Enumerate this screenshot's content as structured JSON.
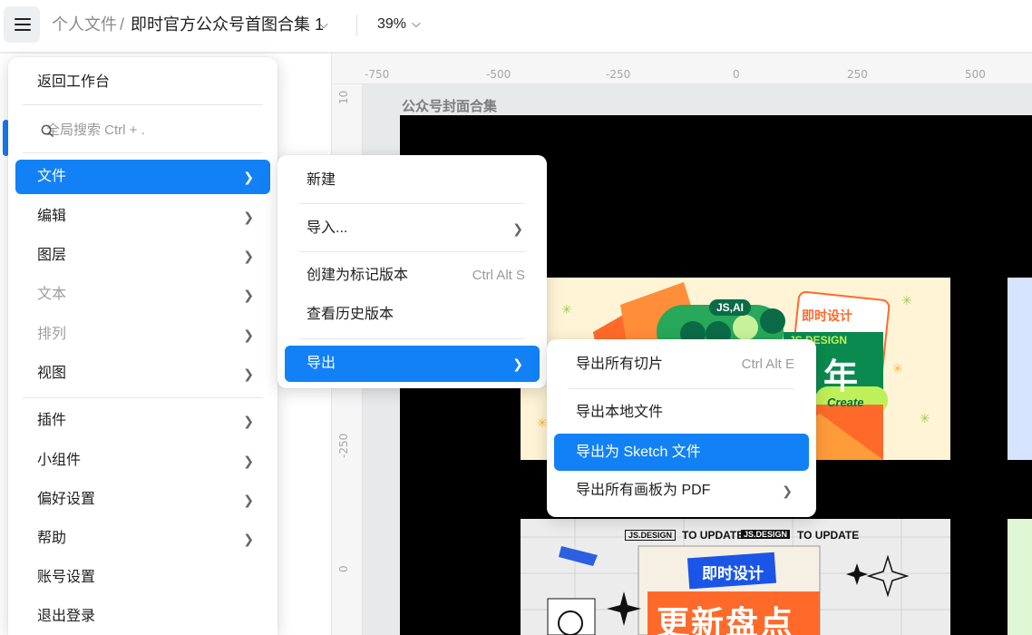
{
  "topbar": {
    "breadcrumb_personal": "个人文件",
    "breadcrumb_sep": "/",
    "file_name": "即时官方公众号首图合集 1",
    "zoom": "39%"
  },
  "canvas": {
    "frame_label": "公众号封面合集",
    "ruler_h": [
      "-750",
      "-500",
      "-250",
      "0",
      "250",
      "500"
    ],
    "ruler_v": [
      "10",
      "-250",
      "0"
    ],
    "card1": {
      "badge_ai": "JS,AI",
      "brand": "即时设计",
      "big": "年",
      "create": "Create",
      "ribbon": "JS DESIGN"
    },
    "card2": {
      "tag1": "JS.DESIGN",
      "upd1": "TO UPDATE",
      "tag2": "JS.DESIGN",
      "upd2": "TO UPDATE",
      "brand": "即时设计",
      "title": "更新盘点"
    }
  },
  "main_menu": {
    "back": "返回工作台",
    "search_placeholder": "全局搜索 Ctrl + .",
    "items": [
      {
        "label": "文件"
      },
      {
        "label": "编辑"
      },
      {
        "label": "图层"
      },
      {
        "label": "文本"
      },
      {
        "label": "排列"
      },
      {
        "label": "视图"
      },
      {
        "label": "插件"
      },
      {
        "label": "小组件"
      },
      {
        "label": "偏好设置"
      },
      {
        "label": "帮助"
      },
      {
        "label": "账号设置"
      },
      {
        "label": "退出登录"
      }
    ]
  },
  "file_menu": {
    "items": [
      {
        "label": "新建"
      },
      {
        "label": "导入..."
      },
      {
        "label": "创建为标记版本",
        "shortcut": "Ctrl Alt S"
      },
      {
        "label": "查看历史版本"
      },
      {
        "label": "导出"
      }
    ]
  },
  "export_menu": {
    "items": [
      {
        "label": "导出所有切片",
        "shortcut": "Ctrl Alt E"
      },
      {
        "label": "导出本地文件"
      },
      {
        "label": "导出为 Sketch 文件"
      },
      {
        "label": "导出所有画板为 PDF"
      }
    ]
  },
  "colors": {
    "accent": "#1281f6",
    "canvas_bg": "#e8e9eb",
    "frame": "#000000"
  }
}
